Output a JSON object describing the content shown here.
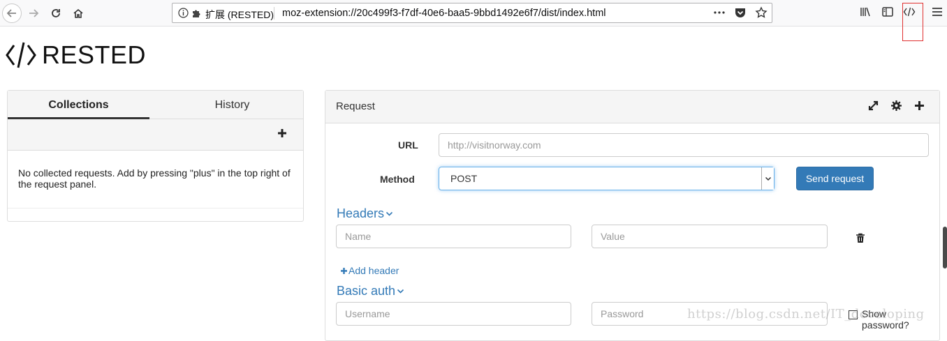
{
  "browser": {
    "identity_label": "扩展 (RESTED)",
    "url": "moz-extension://20c499f3-f7df-40e6-baa5-9bbd1492e6f7/dist/index.html",
    "highlight_color": "#e03030"
  },
  "app": {
    "title": "RESTED",
    "accent": "#337ab7"
  },
  "left_panel": {
    "tabs": [
      {
        "label": "Collections",
        "active": true
      },
      {
        "label": "History",
        "active": false
      }
    ],
    "empty_message": "No collected requests. Add by pressing \"plus\" in the top right of the request panel."
  },
  "request": {
    "title": "Request",
    "icons": [
      "expand-icon",
      "gear-icon",
      "plus-icon"
    ],
    "url_label": "URL",
    "url_placeholder": "http://visitnorway.com",
    "method_label": "Method",
    "method_value": "POST",
    "send_label": "Send request",
    "headers_label": "Headers",
    "header_name_placeholder": "Name",
    "header_value_placeholder": "Value",
    "add_header_label": "Add header",
    "basic_auth_label": "Basic auth",
    "username_placeholder": "Username",
    "password_placeholder": "Password",
    "show_password_label": "Show password?"
  },
  "watermark": "https://blog.csdn.net/IT_developing"
}
